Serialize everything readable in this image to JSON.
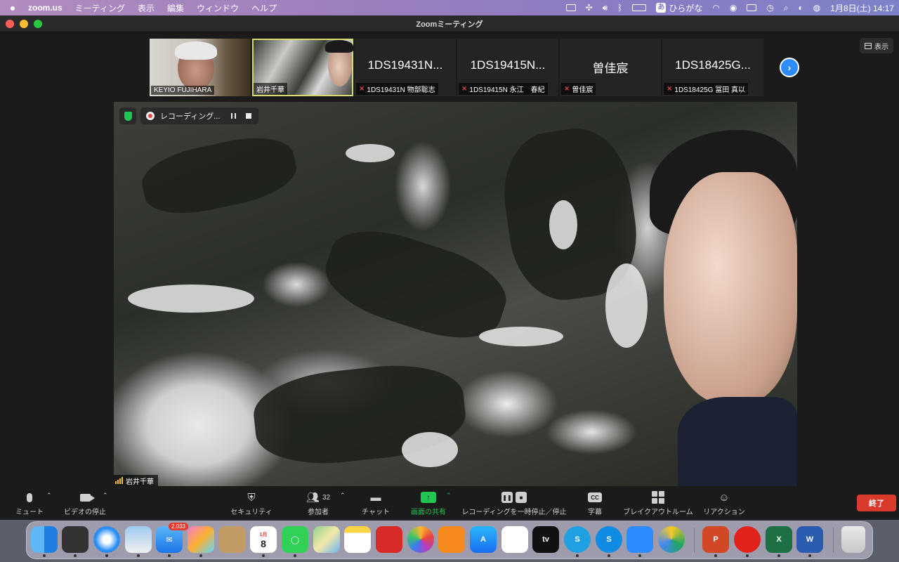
{
  "menubar": {
    "app": "zoom.us",
    "items": [
      "ミーティング",
      "表示",
      "編集",
      "ウィンドウ",
      "ヘルプ"
    ],
    "ime_label": "ひらがな",
    "ime_char": "あ",
    "datetime": "1月8日(土)  14:17"
  },
  "window": {
    "title": "Zoomミーティング",
    "view_label": "表示"
  },
  "thumbnails": [
    {
      "big": "",
      "label": "KEYIO FUJIHARA",
      "muted": false
    },
    {
      "big": "",
      "label": "岩井千華",
      "muted": false,
      "active": true
    },
    {
      "big": "1DS19431N...",
      "label": "1DS19431N 物部聡志",
      "muted": true
    },
    {
      "big": "1DS19415N...",
      "label": "1DS19415N 永江　春紀",
      "muted": true
    },
    {
      "big": "曽佳宸",
      "label": "曽佳宸",
      "muted": true
    },
    {
      "big": "1DS18425G...",
      "label": "1DS18425G 冨田 真以",
      "muted": true
    }
  ],
  "recording": {
    "label": "レコーディング..."
  },
  "main_video": {
    "speaker": "岩井千華"
  },
  "toolbar": {
    "mute": "ミュート",
    "video": "ビデオの停止",
    "security": "セキュリティ",
    "participants": "参加者",
    "participant_count": "32",
    "chat": "チャット",
    "share": "画面の共有",
    "record": "レコーディングを一時停止／停止",
    "captions": "字幕",
    "captions_icon": "CC",
    "breakout": "ブレイクアウトルーム",
    "reactions": "リアクション",
    "end": "終了"
  },
  "dock": {
    "mail_badge": "2,033",
    "calendar_month": "1月",
    "calendar_day": "8",
    "appletv_label": "tv"
  }
}
